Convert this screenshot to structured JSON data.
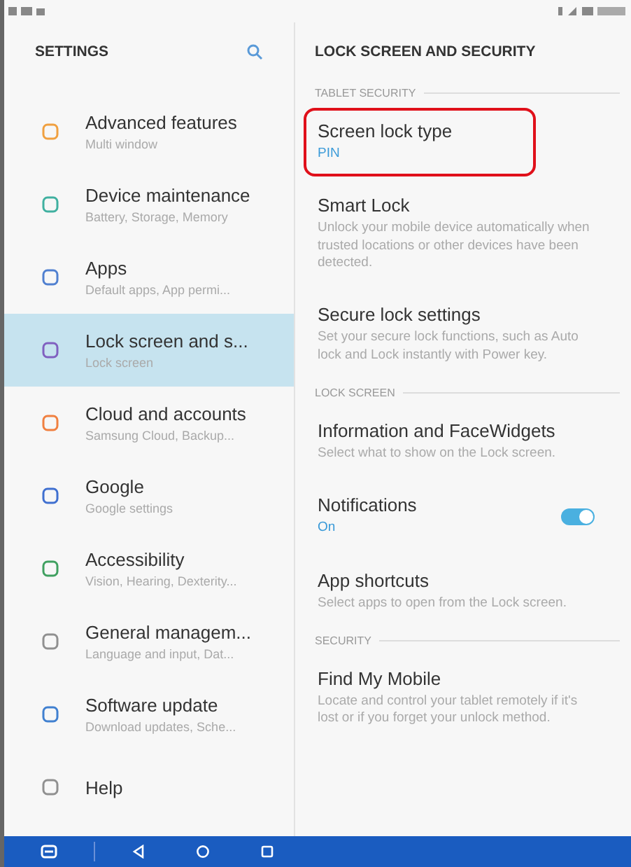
{
  "sidebar": {
    "title": "SETTINGS",
    "items": [
      {
        "title": "Advanced features",
        "subtitle": "Multi window",
        "selected": false
      },
      {
        "title": "Device maintenance",
        "subtitle": "Battery, Storage, Memory",
        "selected": false
      },
      {
        "title": "Apps",
        "subtitle": "Default apps, App permi...",
        "selected": false
      },
      {
        "title": "Lock screen and s...",
        "subtitle": "Lock screen",
        "selected": true
      },
      {
        "title": "Cloud and accounts",
        "subtitle": "Samsung Cloud, Backup...",
        "selected": false
      },
      {
        "title": "Google",
        "subtitle": "Google settings",
        "selected": false
      },
      {
        "title": "Accessibility",
        "subtitle": "Vision, Hearing, Dexterity...",
        "selected": false
      },
      {
        "title": "General managem...",
        "subtitle": "Language and input, Dat...",
        "selected": false
      },
      {
        "title": "Software update",
        "subtitle": "Download updates, Sche...",
        "selected": false
      },
      {
        "title": "Help",
        "selected": false
      }
    ]
  },
  "detail": {
    "title": "LOCK SCREEN AND SECURITY",
    "items": [
      {
        "kind": "section",
        "title": "TABLET SECURITY"
      },
      {
        "kind": "value",
        "title": "Screen lock type",
        "subtitle": "PIN",
        "highlighted": true
      },
      {
        "kind": "setting",
        "title": "Smart Lock",
        "subtitle": "Unlock your mobile device automatically when trusted locations or other devices have been detected.",
        "highlighted": false
      },
      {
        "kind": "setting",
        "title": "Secure lock settings",
        "subtitle": "Set your secure lock functions, such as Auto lock and Lock instantly with Power key.",
        "highlighted": false
      },
      {
        "kind": "section",
        "title": "LOCK SCREEN"
      },
      {
        "kind": "setting",
        "title": "Information and FaceWidgets",
        "subtitle": "Select what to show on the Lock screen.",
        "highlighted": false
      },
      {
        "kind": "toggle",
        "title": "Notifications",
        "subtitle": "On",
        "on": true,
        "highlighted": false
      },
      {
        "kind": "setting",
        "title": "App shortcuts",
        "subtitle": "Select apps to open from the Lock screen.",
        "highlighted": false
      },
      {
        "kind": "section",
        "title": "SECURITY"
      },
      {
        "kind": "setting",
        "title": "Find My Mobile",
        "subtitle": "Locate and control your tablet remotely if it's lost or if you forget your unlock method.",
        "highlighted": false
      }
    ]
  }
}
